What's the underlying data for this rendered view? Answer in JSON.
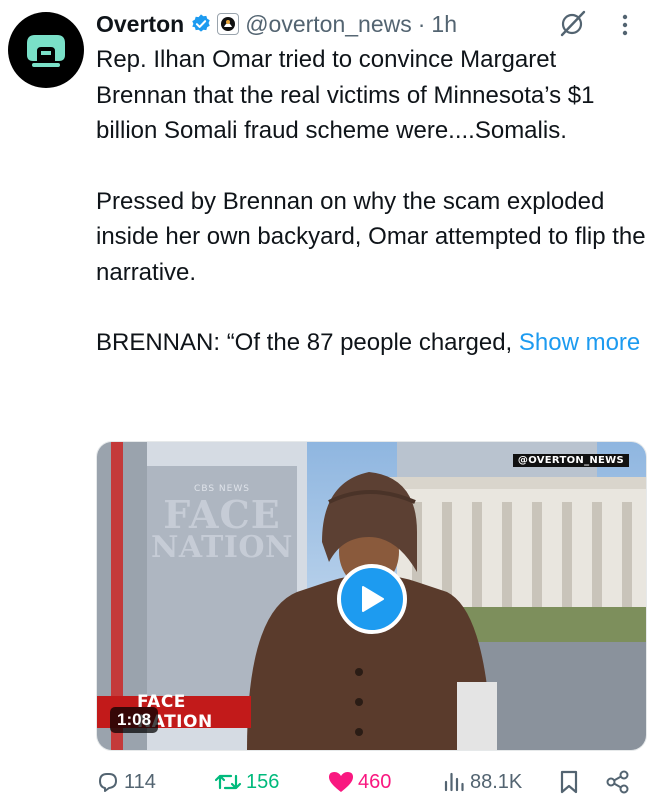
{
  "author": {
    "name": "Overton",
    "handle": "@overton_news",
    "separator": "·",
    "time": "1h"
  },
  "tweet": {
    "p1": "Rep. Ilhan Omar tried to convince Margaret Brennan that the real victims of Minnesota’s $1 billion Somali fraud scheme were....Somalis.",
    "p2": "Pressed by Brennan on why the scam exploded inside her own backyard, Omar attempted to flip the narrative.",
    "p3": "BRENNAN: “Of the 87 people charged,",
    "show_more": "Show more"
  },
  "media": {
    "watermark": "@OVERTON_NEWS",
    "set_sign_top": "CBS NEWS",
    "set_sign_face": "FACE",
    "set_sign_nation": "NATION",
    "lower_third": "FACE NATION",
    "duration": "1:08"
  },
  "metrics": {
    "replies": "114",
    "reposts": "156",
    "likes": "460",
    "views": "88.1K"
  },
  "icons": {
    "avatar": "overton-logo-icon",
    "verified": "verified-badge-icon",
    "affiliate": "affiliate-badge-icon",
    "grok": "grok-icon",
    "more": "more-options-icon",
    "play": "play-icon",
    "reply": "reply-icon",
    "repost": "repost-icon",
    "like": "heart-icon",
    "views": "views-icon",
    "bookmark": "bookmark-icon",
    "share": "share-icon"
  },
  "colors": {
    "accent": "#1d9bf0",
    "repost": "#00ba7c",
    "like": "#f91880",
    "muted": "#536471",
    "avatar_green": "#7ae0c8"
  }
}
